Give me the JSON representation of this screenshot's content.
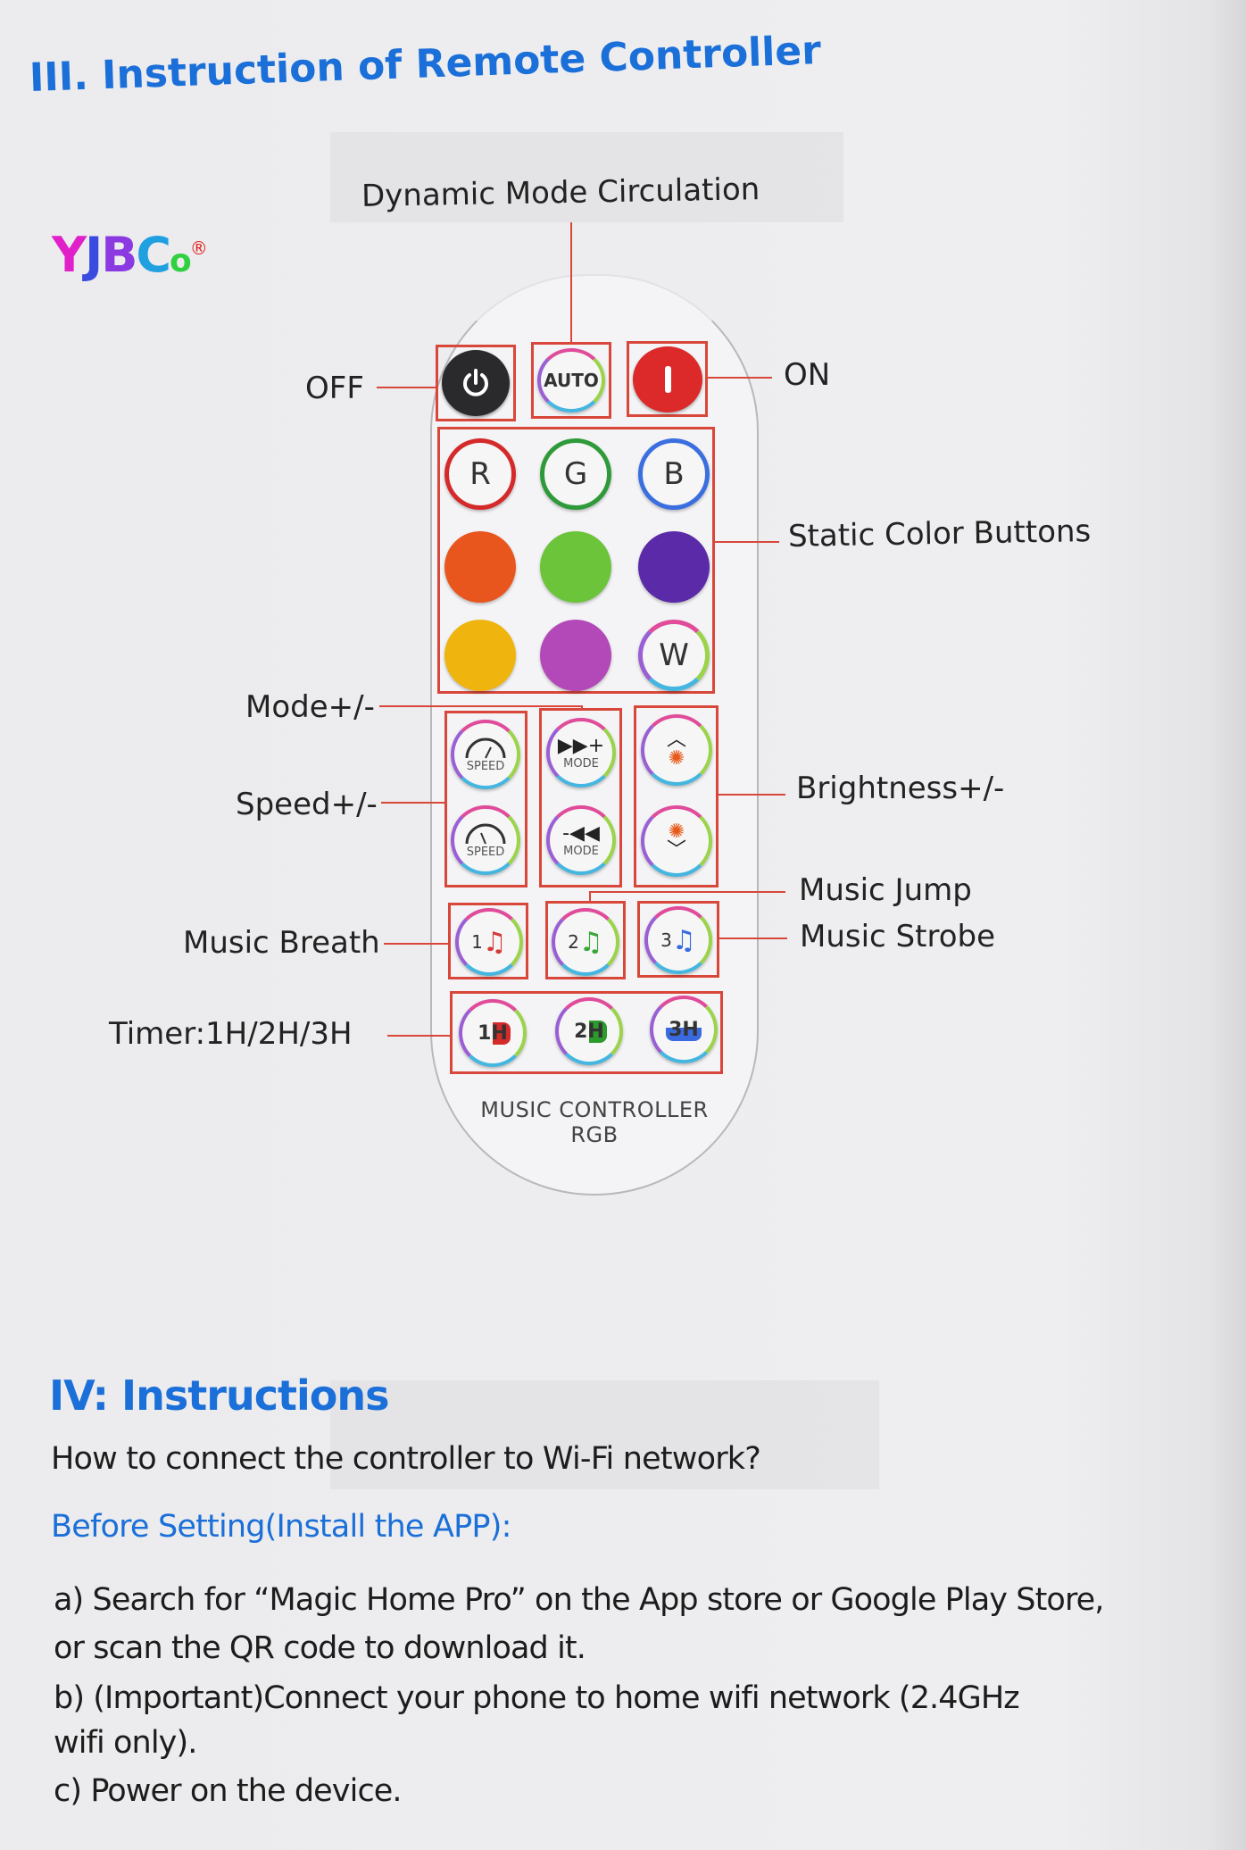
{
  "section3": {
    "title": "III. Instruction of Remote Controller",
    "logo": {
      "text": "YJBCo",
      "mark": "®"
    },
    "labels": {
      "dynamic": "Dynamic Mode Circulation",
      "off": "OFF",
      "on": "ON",
      "static": "Static Color Buttons",
      "mode": "Mode+/-",
      "speed": "Speed+/-",
      "brightness": "Brightness+/-",
      "music_jump": "Music Jump",
      "music_strobe": "Music Strobe",
      "music_breath": "Music Breath",
      "timer": "Timer:1H/2H/3H"
    },
    "remote": {
      "auto": "AUTO",
      "colors": [
        {
          "label": "R",
          "color": "#d42a2a"
        },
        {
          "label": "G",
          "color": "#2f9a3a"
        },
        {
          "label": "B",
          "color": "#3b6fe0"
        },
        {
          "label": "",
          "color": "#e8561e"
        },
        {
          "label": "",
          "color": "#6cc43a"
        },
        {
          "label": "",
          "color": "#5a2aa8"
        },
        {
          "label": "",
          "color": "#f0b40e"
        },
        {
          "label": "",
          "color": "#b348b8"
        },
        {
          "label": "W",
          "color": "#f4f4f4"
        }
      ],
      "speed_label": "SPEED",
      "mode_label": "MODE",
      "music": [
        "1",
        "2",
        "3"
      ],
      "timers": [
        "1H",
        "2H",
        "3H"
      ],
      "footer1": "MUSIC CONTROLLER",
      "footer2": "RGB"
    },
    "accent_line_color": "#d8473a"
  },
  "section4": {
    "title": "IV: Instructions",
    "question": "How to connect the controller to Wi-Fi network?",
    "subtitle": "Before Setting(Install the APP):",
    "lines": [
      "a) Search for “Magic Home Pro” on the App store or Google Play Store,",
      "or scan the QR code to download it.",
      "b) (Important)Connect your phone to home wifi network (2.4GHz",
      "wifi only).",
      "c) Power on the device."
    ]
  },
  "heading_color": "#1b6fd8"
}
